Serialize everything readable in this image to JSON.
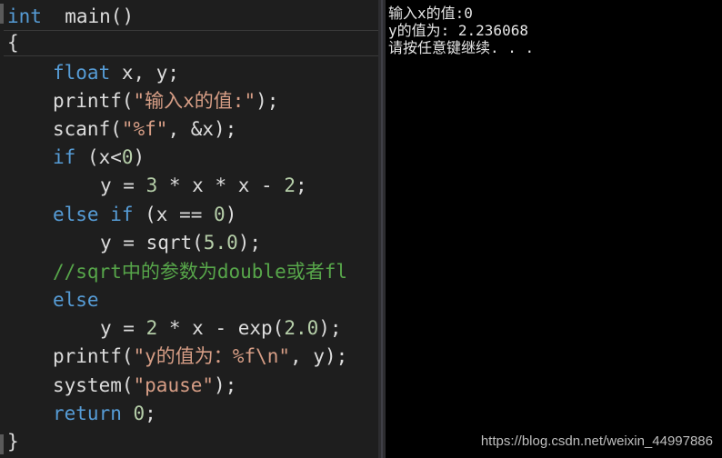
{
  "editor": {
    "lines": [
      {
        "tokens": [
          {
            "cls": "kw",
            "text": "int"
          },
          {
            "cls": "txt",
            "text": "  main()"
          }
        ]
      },
      {
        "tokens": [
          {
            "cls": "txt",
            "text": "{"
          }
        ]
      },
      {
        "tokens": [
          {
            "cls": "kw",
            "text": "float"
          },
          {
            "cls": "txt",
            "text": " x, y;"
          }
        ]
      },
      {
        "tokens": [
          {
            "cls": "txt",
            "text": "printf("
          },
          {
            "cls": "str",
            "text": "\"输入x的值:\""
          },
          {
            "cls": "txt",
            "text": ");"
          }
        ]
      },
      {
        "tokens": [
          {
            "cls": "txt",
            "text": "scanf("
          },
          {
            "cls": "str",
            "text": "\"%f\""
          },
          {
            "cls": "txt",
            "text": ", &x);"
          }
        ]
      },
      {
        "tokens": [
          {
            "cls": "kw",
            "text": "if"
          },
          {
            "cls": "txt",
            "text": " (x<"
          },
          {
            "cls": "num",
            "text": "0"
          },
          {
            "cls": "txt",
            "text": ")"
          }
        ]
      },
      {
        "tokens": [
          {
            "cls": "txt",
            "text": "y = "
          },
          {
            "cls": "num",
            "text": "3"
          },
          {
            "cls": "txt",
            "text": " * x * x - "
          },
          {
            "cls": "num",
            "text": "2"
          },
          {
            "cls": "txt",
            "text": ";"
          }
        ]
      },
      {
        "tokens": [
          {
            "cls": "kw",
            "text": "else if"
          },
          {
            "cls": "txt",
            "text": " (x == "
          },
          {
            "cls": "num",
            "text": "0"
          },
          {
            "cls": "txt",
            "text": ")"
          }
        ]
      },
      {
        "tokens": [
          {
            "cls": "txt",
            "text": "y = sqrt("
          },
          {
            "cls": "num",
            "text": "5.0"
          },
          {
            "cls": "txt",
            "text": ");"
          }
        ]
      },
      {
        "tokens": [
          {
            "cls": "cmt",
            "text": "//sqrt中的参数为double或者fl"
          }
        ]
      },
      {
        "tokens": [
          {
            "cls": "kw",
            "text": "else"
          }
        ]
      },
      {
        "tokens": [
          {
            "cls": "txt",
            "text": "y = "
          },
          {
            "cls": "num",
            "text": "2"
          },
          {
            "cls": "txt",
            "text": " * x - exp("
          },
          {
            "cls": "num",
            "text": "2.0"
          },
          {
            "cls": "txt",
            "text": ");"
          }
        ]
      },
      {
        "tokens": [
          {
            "cls": "txt",
            "text": "printf("
          },
          {
            "cls": "str",
            "text": "\"y的值为：%f\\n\""
          },
          {
            "cls": "txt",
            "text": ", y);"
          }
        ]
      },
      {
        "tokens": [
          {
            "cls": "txt",
            "text": "system("
          },
          {
            "cls": "str",
            "text": "\"pause\""
          },
          {
            "cls": "txt",
            "text": ");"
          }
        ]
      },
      {
        "tokens": [
          {
            "cls": "kw",
            "text": "return"
          },
          {
            "cls": "txt",
            "text": " "
          },
          {
            "cls": "num",
            "text": "0"
          },
          {
            "cls": "txt",
            "text": ";"
          }
        ]
      },
      {
        "tokens": [
          {
            "cls": "txt",
            "text": "}"
          }
        ]
      }
    ]
  },
  "console": {
    "lines": [
      "输入x的值:0",
      "y的值为: 2.236068",
      "请按任意键继续. . ."
    ]
  },
  "watermark": "https://blog.csdn.net/weixin_44997886",
  "colors": {
    "editor_bg": "#1e1e1e",
    "keyword": "#569cd6",
    "string": "#d69d85",
    "number": "#b5cea8",
    "comment": "#57a64a",
    "plain": "#dcdcdc",
    "console_bg": "#000000",
    "console_fg": "#e6e6e6"
  }
}
